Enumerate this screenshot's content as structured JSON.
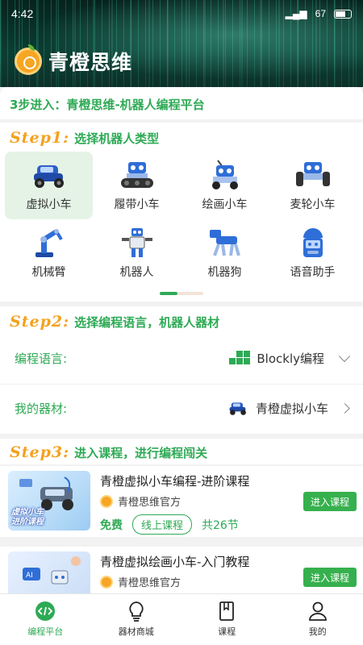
{
  "status_bar": {
    "time": "4:42",
    "battery": "67"
  },
  "header": {
    "brand": "青橙思维"
  },
  "intro": {
    "text": "3步进入：青橙思维-机器人编程平台"
  },
  "step1": {
    "tag": "Step1:",
    "desc": "选择机器人类型",
    "items": [
      {
        "label": "虚拟小车",
        "icon": "virtual-car-icon",
        "selected": true
      },
      {
        "label": "履带小车",
        "icon": "tracked-car-icon"
      },
      {
        "label": "绘画小车",
        "icon": "drawing-car-icon"
      },
      {
        "label": "麦轮小车",
        "icon": "mecanum-car-icon"
      },
      {
        "label": "机械臂",
        "icon": "robot-arm-icon"
      },
      {
        "label": "机器人",
        "icon": "robot-icon"
      },
      {
        "label": "机器狗",
        "icon": "robot-dog-icon"
      },
      {
        "label": "语音助手",
        "icon": "voice-assistant-icon"
      }
    ]
  },
  "step2": {
    "tag": "Step2:",
    "desc": "选择编程语言，机器人器材",
    "language_label": "编程语言:",
    "language_value": "Blockly编程",
    "device_label": "我的器材:",
    "device_value": "青橙虚拟小车"
  },
  "step3": {
    "tag": "Step3:",
    "desc": "进入课程，进行编程闯关",
    "courses": [
      {
        "title": "青橙虚拟小车编程-进阶课程",
        "author": "青橙思维官方",
        "price": "免费",
        "type": "线上课程",
        "lessons": "共26节",
        "button": "进入课程",
        "thumb_text": "虚拟小车\n进阶课程"
      },
      {
        "title": "青橙虚拟绘画小车-入门教程",
        "author": "青橙思维官方",
        "button": "进入课程"
      }
    ]
  },
  "tabbar": [
    {
      "label": "编程平台",
      "icon": "code-icon",
      "active": true
    },
    {
      "label": "器材商城",
      "icon": "lightbulb-icon"
    },
    {
      "label": "课程",
      "icon": "book-icon"
    },
    {
      "label": "我的",
      "icon": "user-icon"
    }
  ],
  "colors": {
    "accent": "#2eaa55",
    "step_tag": "#f4a21e",
    "button": "#36b04d"
  }
}
